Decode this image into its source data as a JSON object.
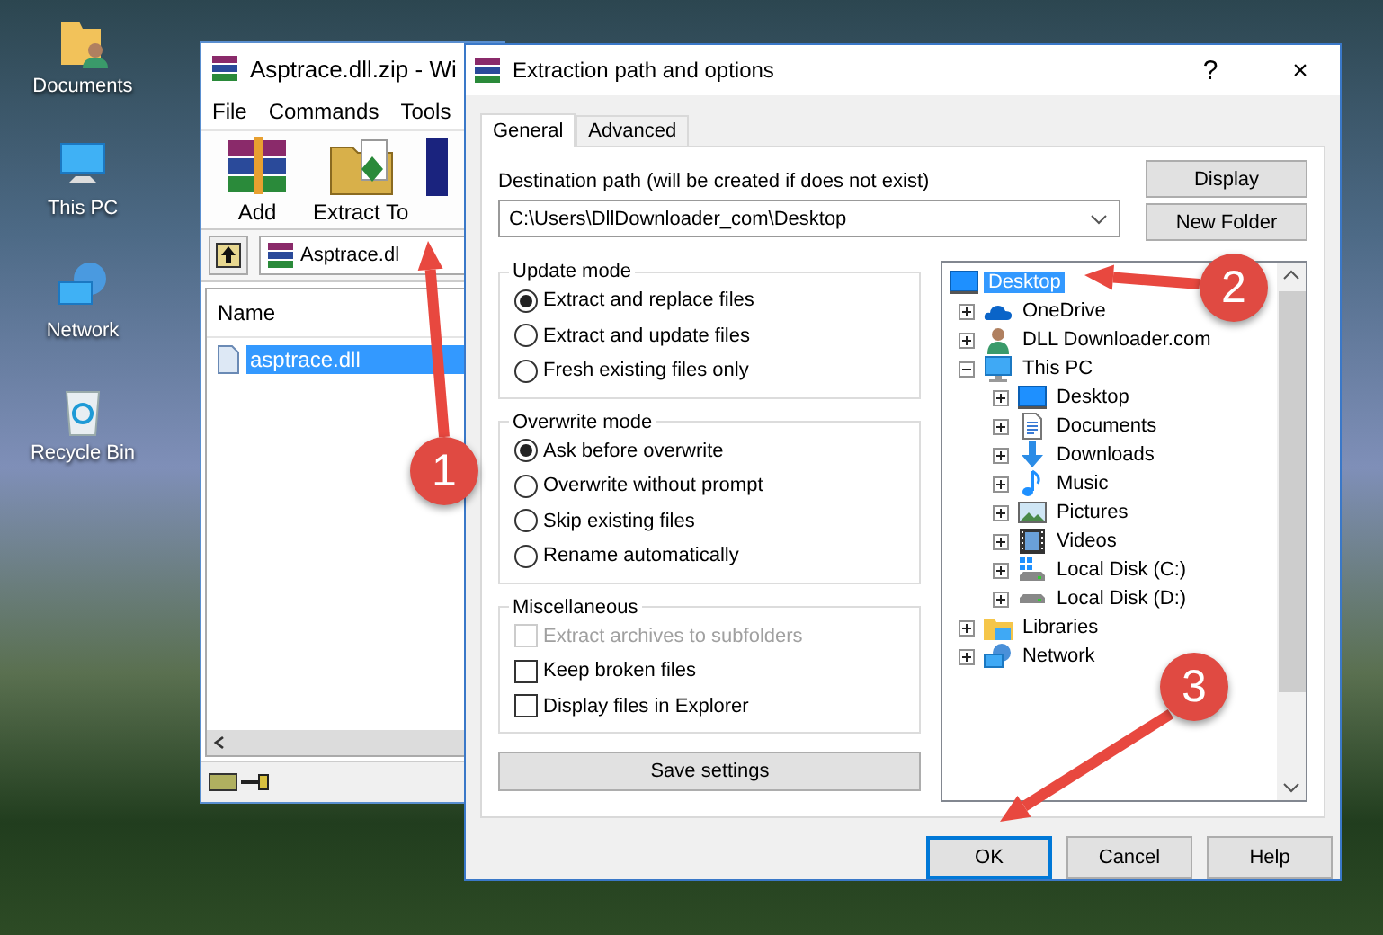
{
  "desktop": {
    "icons": [
      {
        "label": "Documents",
        "kind": "documents"
      },
      {
        "label": "This PC",
        "kind": "pc"
      },
      {
        "label": "Network",
        "kind": "network"
      },
      {
        "label": "Recycle Bin",
        "kind": "recycle"
      }
    ]
  },
  "archive_window": {
    "title": "Asptrace.dll.zip - Wi",
    "menu": [
      "File",
      "Commands",
      "Tools"
    ],
    "toolbar": [
      {
        "label": "Add",
        "kind": "add"
      },
      {
        "label": "Extract To",
        "kind": "extract"
      }
    ],
    "address": "Asptrace.dl",
    "columns": [
      "Name"
    ],
    "files": [
      {
        "name": "asptrace.dll",
        "selected": true
      }
    ]
  },
  "dialog": {
    "title": "Extraction path and options",
    "help_glyph": "?",
    "close_glyph": "×",
    "tabs": [
      {
        "label": "General",
        "selected": true
      },
      {
        "label": "Advanced",
        "selected": false
      }
    ],
    "destination_label": "Destination path (will be created if does not exist)",
    "destination_path": "C:\\Users\\DllDownloader_com\\Desktop",
    "side_buttons": [
      "Display",
      "New Folder"
    ],
    "groups": [
      {
        "title": "Update mode",
        "items": [
          {
            "kind": "radio",
            "label": "Extract and replace files",
            "checked": true,
            "disabled": false
          },
          {
            "kind": "radio",
            "label": "Extract and update files",
            "checked": false,
            "disabled": false
          },
          {
            "kind": "radio",
            "label": "Fresh existing files only",
            "checked": false,
            "disabled": false
          }
        ]
      },
      {
        "title": "Overwrite mode",
        "items": [
          {
            "kind": "radio",
            "label": "Ask before overwrite",
            "checked": true,
            "disabled": false
          },
          {
            "kind": "radio",
            "label": "Overwrite without prompt",
            "checked": false,
            "disabled": false
          },
          {
            "kind": "radio",
            "label": "Skip existing files",
            "checked": false,
            "disabled": false
          },
          {
            "kind": "radio",
            "label": "Rename automatically",
            "checked": false,
            "disabled": false
          }
        ]
      },
      {
        "title": "Miscellaneous",
        "items": [
          {
            "kind": "checkbox",
            "label": "Extract archives to subfolders",
            "checked": false,
            "disabled": true
          },
          {
            "kind": "checkbox",
            "label": "Keep broken files",
            "checked": false,
            "disabled": false
          },
          {
            "kind": "checkbox",
            "label": "Display files in Explorer",
            "checked": false,
            "disabled": false
          }
        ]
      }
    ],
    "save_button": "Save settings",
    "tree": {
      "label": "Desktop",
      "kind": "desktop",
      "selected": true,
      "children": [
        {
          "label": "OneDrive",
          "kind": "cloud",
          "selected": false,
          "expanded": false
        },
        {
          "label": "DLL Downloader.com",
          "kind": "user",
          "selected": false,
          "expanded": false
        },
        {
          "label": "This PC",
          "kind": "pc",
          "selected": false,
          "expanded": true,
          "children": [
            {
              "label": "Desktop",
              "kind": "desktop",
              "selected": false,
              "expanded": false
            },
            {
              "label": "Documents",
              "kind": "docs",
              "selected": false,
              "expanded": false
            },
            {
              "label": "Downloads",
              "kind": "download",
              "selected": false,
              "expanded": false
            },
            {
              "label": "Music",
              "kind": "music",
              "selected": false,
              "expanded": false
            },
            {
              "label": "Pictures",
              "kind": "pictures",
              "selected": false,
              "expanded": false
            },
            {
              "label": "Videos",
              "kind": "videos",
              "selected": false,
              "expanded": false
            },
            {
              "label": "Local Disk (C:)",
              "kind": "system-disk",
              "selected": false,
              "expanded": false
            },
            {
              "label": "Local Disk (D:)",
              "kind": "disk",
              "selected": false,
              "expanded": false
            }
          ]
        },
        {
          "label": "Libraries",
          "kind": "library",
          "selected": false,
          "expanded": false
        },
        {
          "label": "Network",
          "kind": "network",
          "selected": false,
          "expanded": false
        }
      ]
    },
    "buttons": [
      {
        "label": "OK",
        "default": true
      },
      {
        "label": "Cancel",
        "default": false
      },
      {
        "label": "Help",
        "default": false
      }
    ]
  },
  "callouts": [
    {
      "number": "1"
    },
    {
      "number": "2"
    },
    {
      "number": "3"
    }
  ]
}
